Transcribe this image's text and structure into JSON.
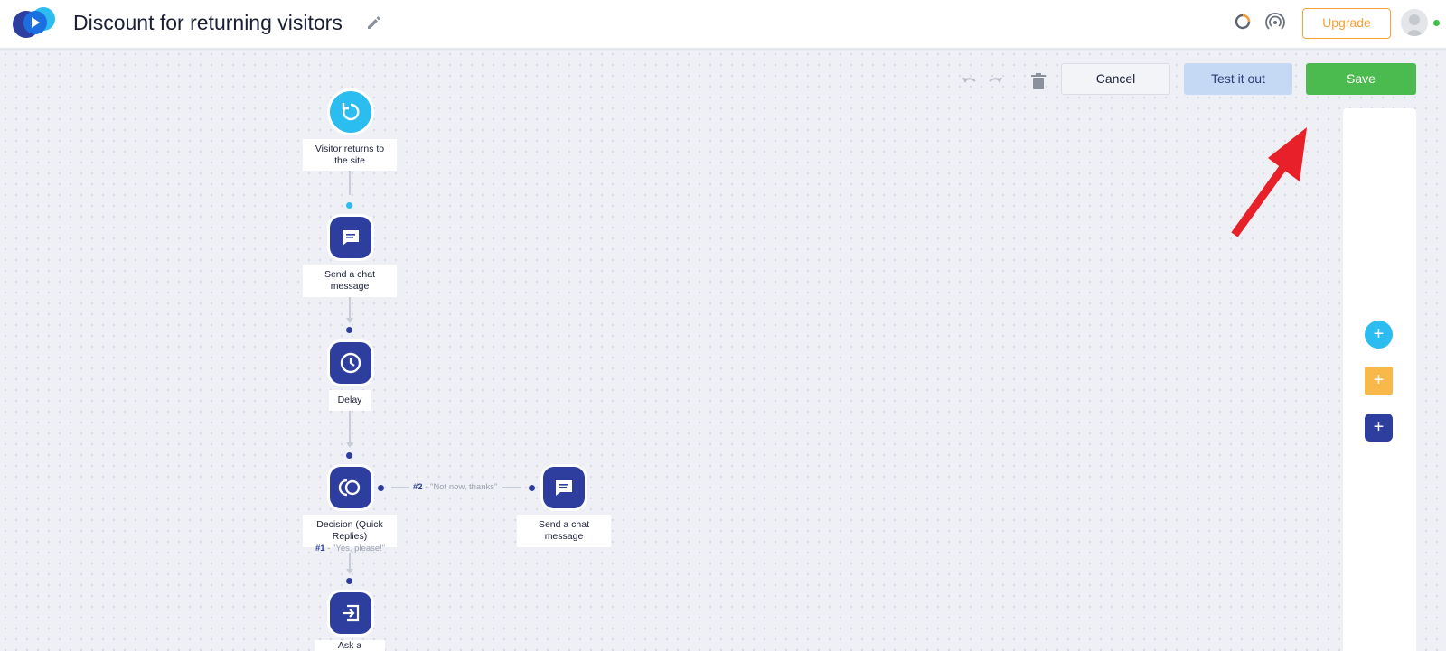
{
  "header": {
    "title": "Discount for returning visitors",
    "upgrade_label": "Upgrade"
  },
  "toolbar": {
    "cancel_label": "Cancel",
    "test_label": "Test it out",
    "save_label": "Save"
  },
  "flow": {
    "nodes": [
      {
        "label": "Visitor returns to the site",
        "icon": "refresh-icon",
        "kind": "trigger"
      },
      {
        "label": "Send a chat message",
        "icon": "chat-icon",
        "kind": "action"
      },
      {
        "label": "Delay",
        "icon": "clock-icon",
        "kind": "action"
      },
      {
        "label": "Decision (Quick Replies)",
        "icon": "decision-icon",
        "kind": "action"
      },
      {
        "label": "Send a chat message",
        "icon": "chat-icon",
        "kind": "action"
      },
      {
        "label": "Ask a question",
        "icon": "ask-question-icon",
        "kind": "action"
      }
    ],
    "branches": [
      {
        "num": "#2",
        "text": " - \"Not now, thanks\""
      },
      {
        "num": "#1",
        "text": " - \"Yes, please!\""
      }
    ]
  },
  "side_panel": {
    "buttons": [
      "add-trigger",
      "add-condition",
      "add-action"
    ]
  },
  "colors": {
    "trigger": "#2bbcf0",
    "action": "#2d3e9f",
    "condition": "#f9b84a",
    "save": "#4cbb4f",
    "upgrade": "#f5a13a"
  }
}
